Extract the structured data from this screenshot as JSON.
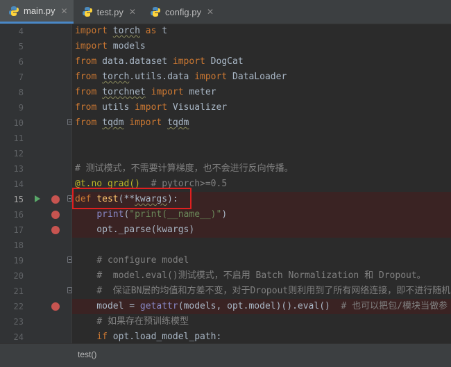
{
  "tabs": [
    {
      "label": "main.py",
      "active": true
    },
    {
      "label": "test.py",
      "active": false
    },
    {
      "label": "config.py",
      "active": false
    }
  ],
  "gutter": {
    "line_numbers": [
      "4",
      "5",
      "6",
      "7",
      "8",
      "9",
      "10",
      "11",
      "12",
      "13",
      "14",
      "15",
      "16",
      "17",
      "18",
      "19",
      "20",
      "21",
      "22",
      "23",
      "24"
    ],
    "current_line": "15",
    "breakpoint_lines": [
      "15",
      "16",
      "17",
      "22"
    ],
    "run_line": "15"
  },
  "code_lines": [
    "import torch as t",
    "import models",
    "from data.dataset import DogCat",
    "from torch.utils.data import DataLoader",
    "from torchnet import meter",
    "from utils import Visualizer",
    "from tqdm import tqdm",
    "",
    "",
    "# 测试模式，不需要计算梯度，也不会进行反向传播。",
    "@t.no_grad()  # pytorch>=0.5",
    "def test(**kwargs):",
    "    print(\"print(__name__)\")",
    "    opt._parse(kwargs)",
    "",
    "    # configure model",
    "    #  model.eval()测试模式，不启用 Batch Normalization 和 Dropout。",
    "    #  保证BN层的均值和方差不变，对于Dropout则利用到了所有网络连接，即不进行随机",
    "    model = getattr(models, opt.model)().eval()  # 也可以把包/模块当做参",
    "    # 如果存在预训练模型",
    "    if opt.load_model_path:"
  ],
  "breadcrumb": "test()",
  "colors": {
    "background": "#2b2b2b",
    "keyword": "#cc7832",
    "comment": "#808080",
    "string": "#6a8759",
    "decorator": "#bbb529",
    "function": "#ffc66d",
    "builtin": "#8888c6",
    "breakpoint": "#c75450",
    "highlight_box": "#e02020"
  }
}
